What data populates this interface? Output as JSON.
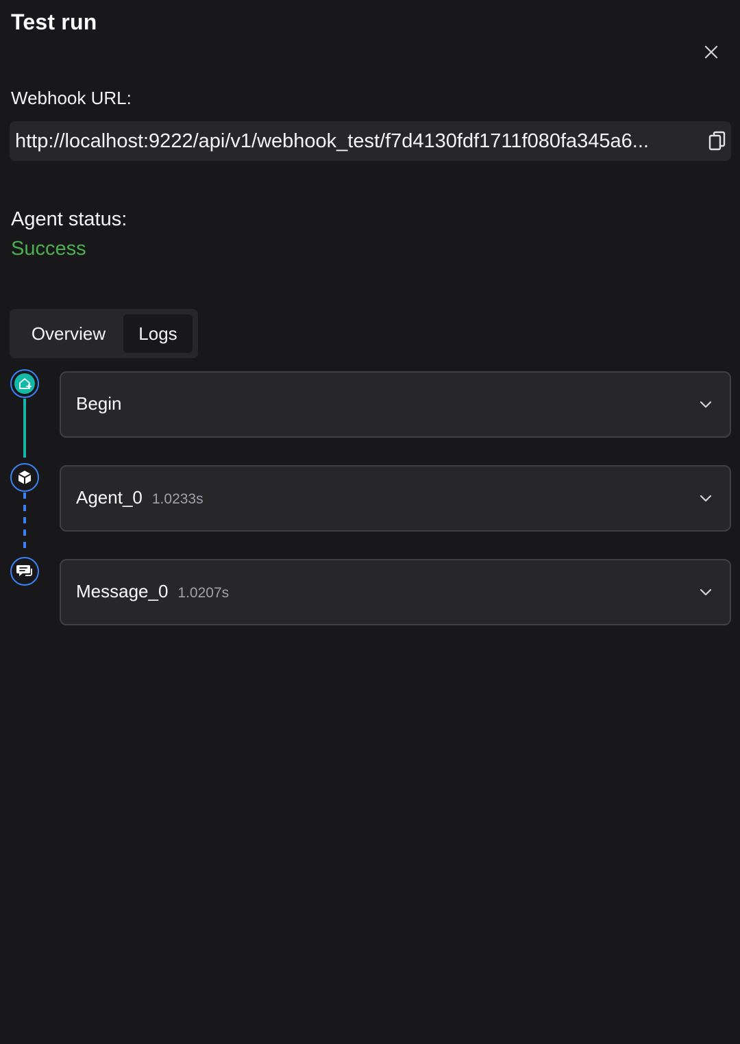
{
  "header": {
    "title": "Test run"
  },
  "webhook": {
    "label": "Webhook URL:",
    "url": "http://localhost:9222/api/v1/webhook_test/f7d4130fdf1711f080fa345a6..."
  },
  "agent_status": {
    "label": "Agent status:",
    "value": "Success",
    "value_color": "#4caf50"
  },
  "tabs": [
    {
      "label": "Overview",
      "selected": false
    },
    {
      "label": "Logs",
      "selected": true
    }
  ],
  "logs": [
    {
      "name": "Begin",
      "duration": "",
      "icon": "home-plus-icon"
    },
    {
      "name": "Agent_0",
      "duration": "1.0233s",
      "icon": "cube-icon"
    },
    {
      "name": "Message_0",
      "duration": "1.0207s",
      "icon": "message-bubble-icon"
    }
  ],
  "colors": {
    "background": "#18181b",
    "surface": "#27272a",
    "accent_teal": "#14b8a6",
    "accent_blue": "#3b82f6",
    "success": "#4caf50"
  }
}
